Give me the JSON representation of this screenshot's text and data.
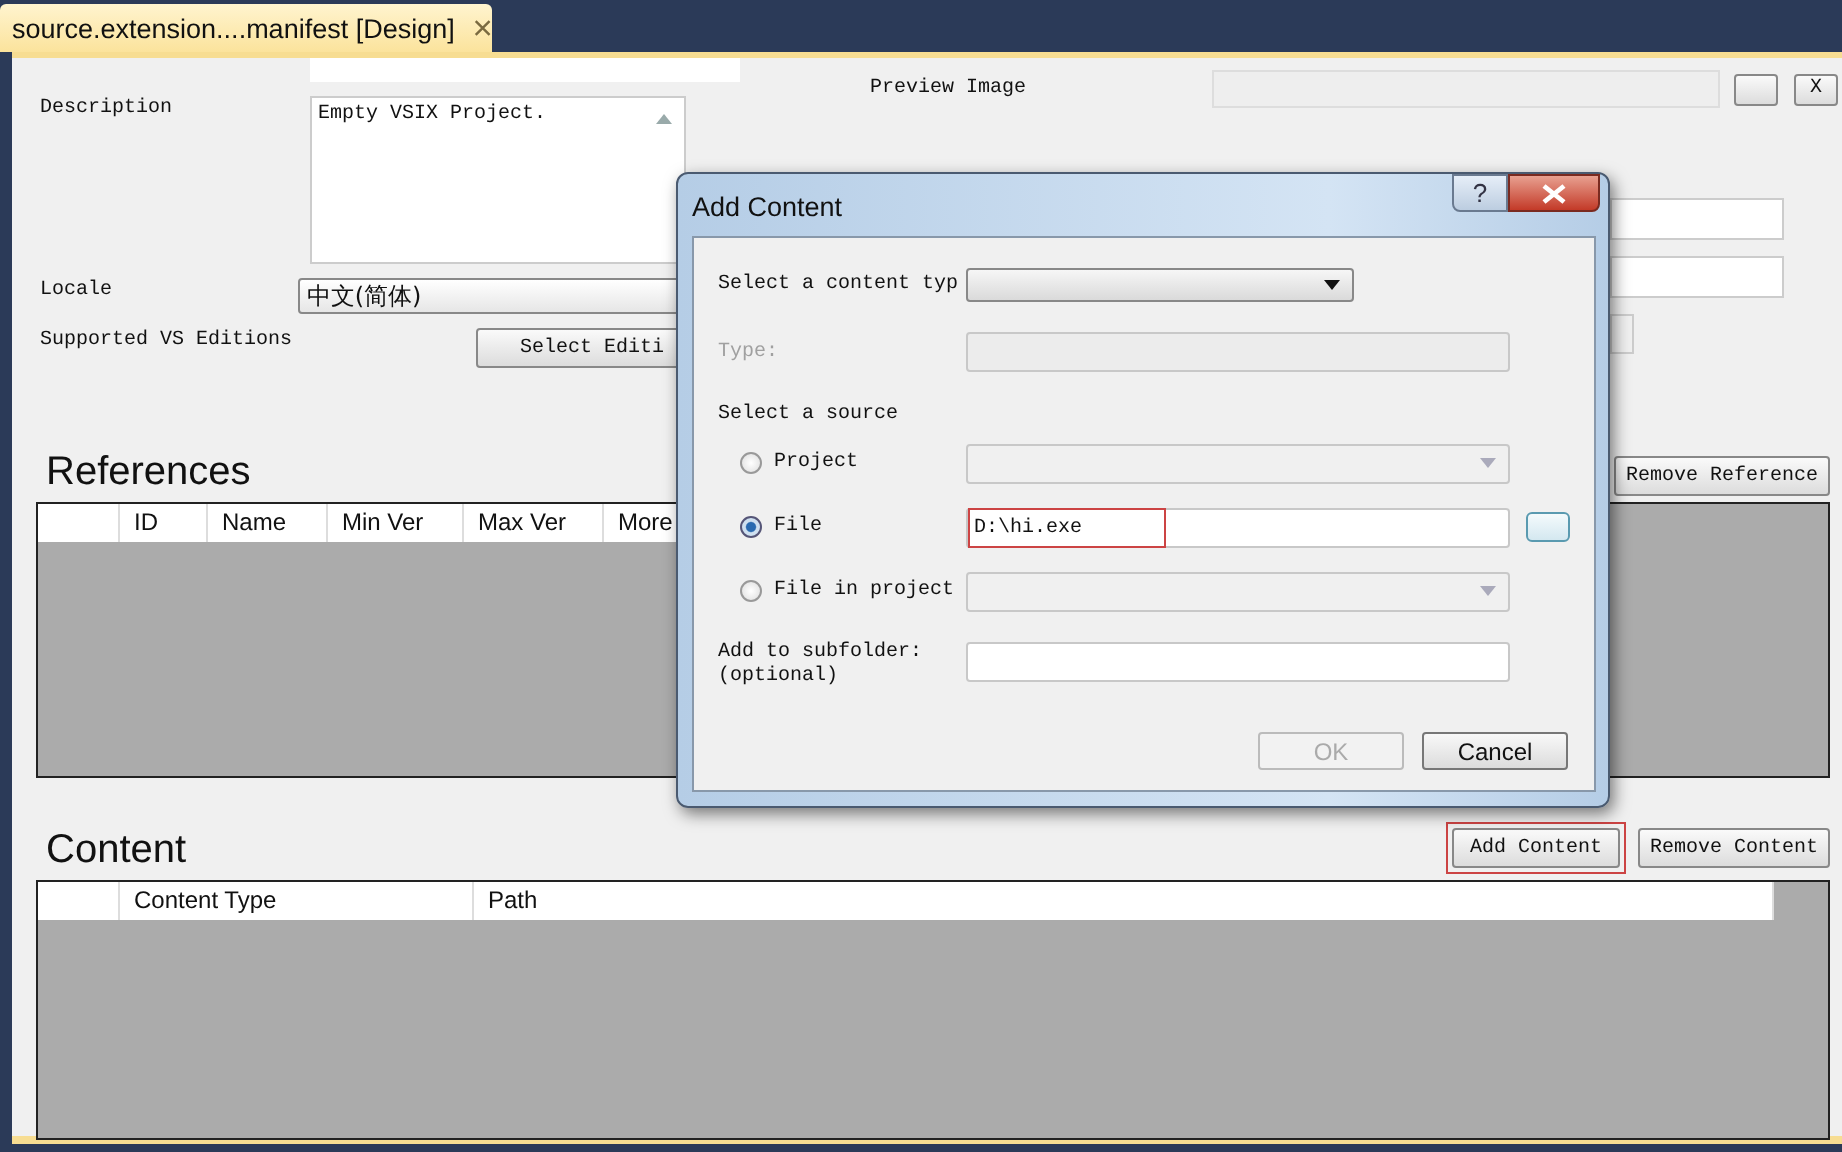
{
  "tab": {
    "title": "source.extension....manifest [Design]",
    "selected": true
  },
  "form": {
    "description_label": "Description",
    "description_value": "Empty VSIX Project.",
    "locale_label": "Locale",
    "locale_value": "中文(简体)",
    "editions_label": "Supported VS Editions",
    "editions_button": "Select Editi",
    "preview_label": "Preview Image",
    "preview_clear": "X"
  },
  "references": {
    "title": "References",
    "remove_button": "Remove Reference",
    "columns": [
      "ID",
      "Name",
      "Min Ver",
      "Max Ver",
      "More"
    ]
  },
  "content": {
    "title": "Content",
    "add_button": "Add Content",
    "add_highlighted": true,
    "remove_button": "Remove Content",
    "columns": [
      "Content Type",
      "Path"
    ]
  },
  "dialog": {
    "title": "Add Content",
    "help": "?",
    "content_type_label": "Select a content typ",
    "type_label": "Type:",
    "type_disabled": true,
    "source_label": "Select a source",
    "sources": [
      {
        "label": "Project",
        "selected": false,
        "kind": "combo"
      },
      {
        "label": "File",
        "selected": true,
        "kind": "file",
        "value": "D:\\hi.exe",
        "highlighted": true
      },
      {
        "label": "File in project",
        "selected": false,
        "kind": "combo"
      }
    ],
    "subfolder_label": "Add to subfolder:\n(optional)",
    "ok": {
      "label": "OK",
      "disabled": true
    },
    "cancel": {
      "label": "Cancel",
      "disabled": false
    }
  }
}
